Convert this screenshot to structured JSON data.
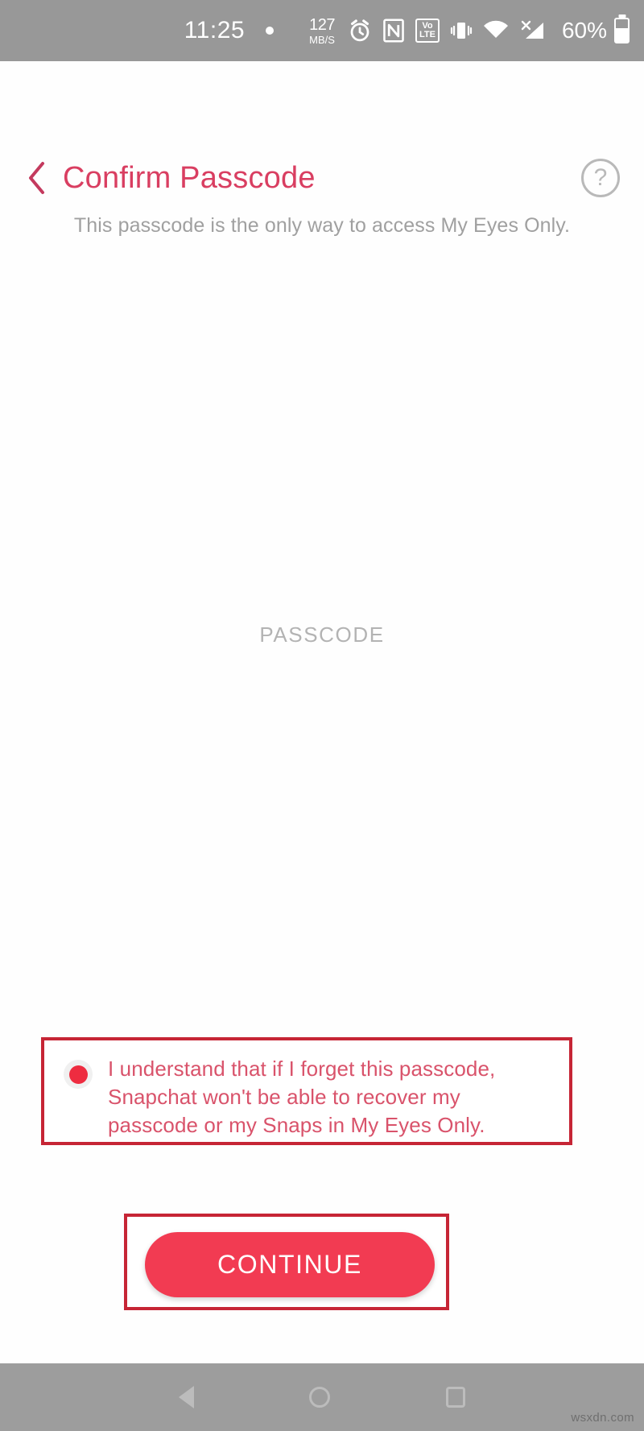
{
  "status_bar": {
    "time": "11:25",
    "data_speed_value": "127",
    "data_speed_unit": "MB/S",
    "volte_top": "Vo",
    "volte_bottom": "LTE",
    "battery_percent": "60%",
    "icons": [
      "notification-dot",
      "data-speed",
      "alarm-icon",
      "nfc-icon",
      "volte-icon",
      "vibrate-icon",
      "wifi-icon",
      "cellular-signal-icon",
      "battery-icon"
    ],
    "background_color": "#989898"
  },
  "header": {
    "back_label": "‹",
    "title": "Confirm Passcode",
    "help_label": "?",
    "title_color": "#d93e61"
  },
  "subtitle": "This passcode is the only way to access My Eyes Only.",
  "passcode_field": {
    "placeholder": "PASSCODE",
    "value": ""
  },
  "consent": {
    "text": "I understand that if I forget this passcode, Snapchat won't be able to recover my passcode or my Snaps in My Eyes Only.",
    "checked": true,
    "text_color": "#d9536b",
    "dot_color": "#ee2c40"
  },
  "continue_button": {
    "label": "CONTINUE",
    "background_color": "#f23b52",
    "text_color": "#ffffff"
  },
  "annotations": {
    "border_color": "#c62535",
    "targets": [
      "consent-checkbox-block",
      "continue-button"
    ]
  },
  "nav_bar": {
    "back_label": "back-triangle",
    "home_label": "home-circle",
    "recents_label": "recents-square",
    "background_color": "#9d9d9d"
  },
  "watermark": "wsxdn.com"
}
